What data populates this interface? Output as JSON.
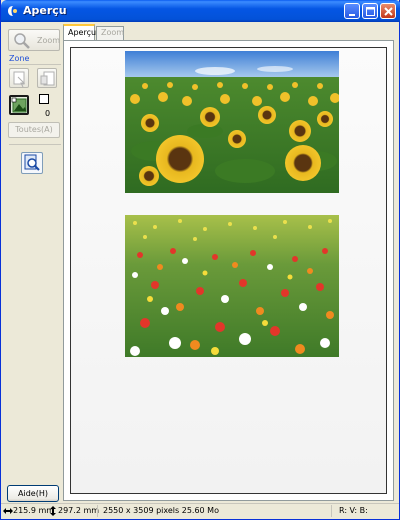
{
  "window": {
    "title": "Aperçu"
  },
  "left_panel": {
    "zoom_label": "Zoom",
    "zone_label": "Zone",
    "zone_count": "0",
    "toutes_label": "Toutes(A)",
    "help_label": "Aide(H)"
  },
  "tabs": [
    {
      "label": "Aperçu",
      "active": true
    },
    {
      "label": "Zoom",
      "active": false
    }
  ],
  "status": {
    "width": "215.9 mm",
    "height": "297.2 mm",
    "pixels": "2550 x 3509 pixels 25.60 Mo",
    "rgb": "R: V: B:"
  },
  "colors": {
    "titlebar": "#0556e4",
    "window_bg": "#ece9d8",
    "zone_label": "#2050d8"
  }
}
